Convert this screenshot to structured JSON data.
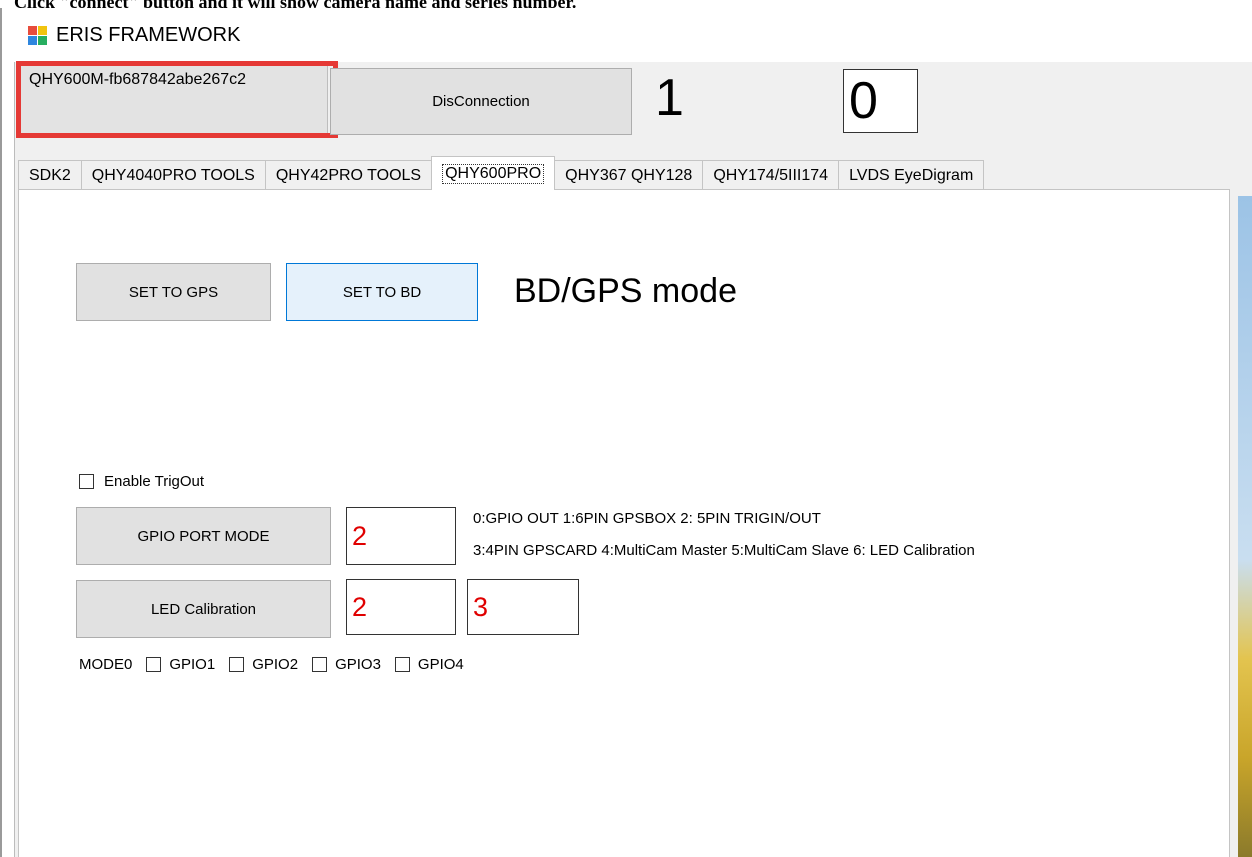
{
  "caption": "Click \"connect\" button and it will show camera name and series number.",
  "window": {
    "title": "ERIS FRAMEWORK"
  },
  "top_bar": {
    "camera_name": "QHY600M-fb687842abe267c2",
    "disconnect_label": "DisConnection",
    "count_value": "1",
    "box_value": "0"
  },
  "tabs": [
    {
      "label": "SDK2",
      "selected": false
    },
    {
      "label": "QHY4040PRO TOOLS",
      "selected": false
    },
    {
      "label": "QHY42PRO TOOLS",
      "selected": false
    },
    {
      "label": "QHY600PRO",
      "selected": true
    },
    {
      "label": "QHY367 QHY128",
      "selected": false
    },
    {
      "label": "QHY174/5III174",
      "selected": false
    },
    {
      "label": "LVDS EyeDigram",
      "selected": false
    }
  ],
  "panel": {
    "set_gps_label": "SET TO GPS",
    "set_bd_label": "SET TO BD",
    "mode_title": "BD/GPS mode",
    "enable_trigout_label": "Enable TrigOut",
    "enable_trigout_checked": false,
    "gpio_port_mode_label": "GPIO PORT MODE",
    "gpio_port_mode_value": "2",
    "gpio_help_line1": "0:GPIO OUT  1:6PIN GPSBOX  2: 5PIN TRIGIN/OUT",
    "gpio_help_line2": "3:4PIN GPSCARD 4:MultiCam Master 5:MultiCam Slave 6: LED Calibration",
    "led_calibration_label": "LED Calibration",
    "led_value_a": "2",
    "led_value_b": "3",
    "mode0_label": "MODE0",
    "gpio_checkboxes": [
      {
        "label": "GPIO1",
        "checked": false
      },
      {
        "label": "GPIO2",
        "checked": false
      },
      {
        "label": "GPIO3",
        "checked": false
      },
      {
        "label": "GPIO4",
        "checked": false
      }
    ]
  },
  "colors": {
    "highlight_frame": "#e53935",
    "value_text": "#e00000",
    "active_button_border": "#0078d7"
  },
  "icons": {
    "app": "windows-forms-app-icon",
    "checkbox": "checkbox-unchecked"
  }
}
